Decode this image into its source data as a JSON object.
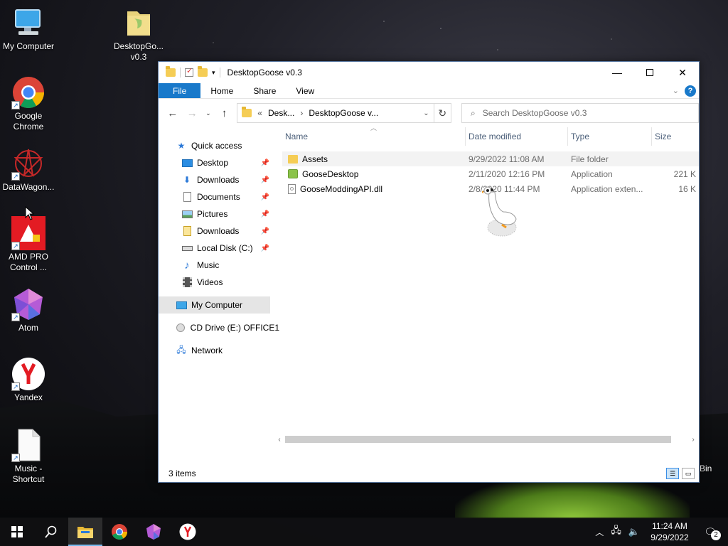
{
  "desktop": {
    "icons": [
      {
        "label": "My Computer"
      },
      {
        "label": "DesktopGo... v0.3"
      },
      {
        "label": "Google Chrome"
      },
      {
        "label": "DataWagon..."
      },
      {
        "label": "AMD PRO Control ..."
      },
      {
        "label": "Atom"
      },
      {
        "label": "Yandex"
      },
      {
        "label": "Music - Shortcut"
      }
    ],
    "recycle_bin_label": "Bin"
  },
  "window": {
    "title": "DesktopGoose v0.3",
    "ribbon_tabs": [
      "File",
      "Home",
      "Share",
      "View"
    ],
    "help_label": "?",
    "address": {
      "root_chevrons": "«",
      "crumbs": [
        "Desk...",
        "DesktopGoose v..."
      ]
    },
    "search_placeholder": "Search DesktopGoose v0.3",
    "nav": {
      "quick_access": "Quick access",
      "quick_items": [
        "Desktop",
        "Downloads",
        "Documents",
        "Pictures",
        "Downloads",
        "Local Disk (C:)",
        "Music",
        "Videos"
      ],
      "my_computer": "My Computer",
      "cd_drive": "CD Drive (E:) OFFICE1",
      "network": "Network"
    },
    "columns": [
      "Name",
      "Date modified",
      "Type",
      "Size"
    ],
    "files": [
      {
        "name": "Assets",
        "date": "9/29/2022 11:08 AM",
        "type": "File folder",
        "size": "",
        "icon": "folder-icon"
      },
      {
        "name": "GooseDesktop",
        "date": "2/11/2020 12:16 PM",
        "type": "Application",
        "size": "221 K",
        "icon": "application-icon"
      },
      {
        "name": "GooseModdingAPI.dll",
        "date": "2/8/2020 11:44 PM",
        "type": "Application exten...",
        "size": "16 K",
        "icon": "dll-file-icon"
      }
    ],
    "status": "3 items"
  },
  "taskbar": {
    "time": "11:24 AM",
    "date": "9/29/2022",
    "notification_count": "2"
  }
}
